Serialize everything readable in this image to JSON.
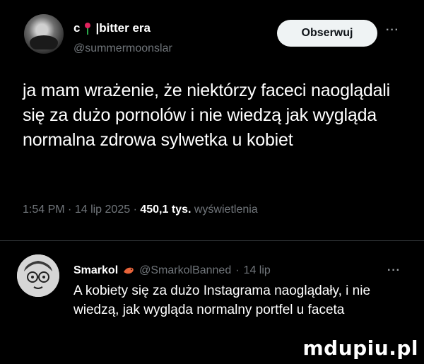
{
  "post": {
    "author": {
      "display_name": "c",
      "display_name_suffix": "|bitter era",
      "badge_icon": "rose-icon",
      "handle": "@summermoonslar"
    },
    "follow_label": "Obserwuj",
    "more_label": "···",
    "text": "ja mam wrażenie, że niektórzy faceci naoglądali się za dużo pornolów i nie wiedzą jak wygląda normalna zdrowa  sylwetka u kobiet",
    "time": "1:54 PM",
    "date": "14 lip 2025",
    "separator": "·",
    "views_count": "450,1 tys.",
    "views_label": "wyświetlenia"
  },
  "reply": {
    "display_name": "Smarkol",
    "badge_icon": "shrimp-icon",
    "handle": "@SmarkolBanned",
    "separator": "·",
    "date": "14 lip",
    "more_label": "···",
    "text": "A kobiety się za dużo Instagrama naoglądały, i nie wiedzą, jak wygląda normalny portfel u faceta"
  },
  "watermark": "mdupiu.pl",
  "colors": {
    "background": "#000000",
    "text": "#ffffff",
    "secondary": "#71767b",
    "follow_bg": "#eff3f4",
    "divider": "#2f3336"
  }
}
